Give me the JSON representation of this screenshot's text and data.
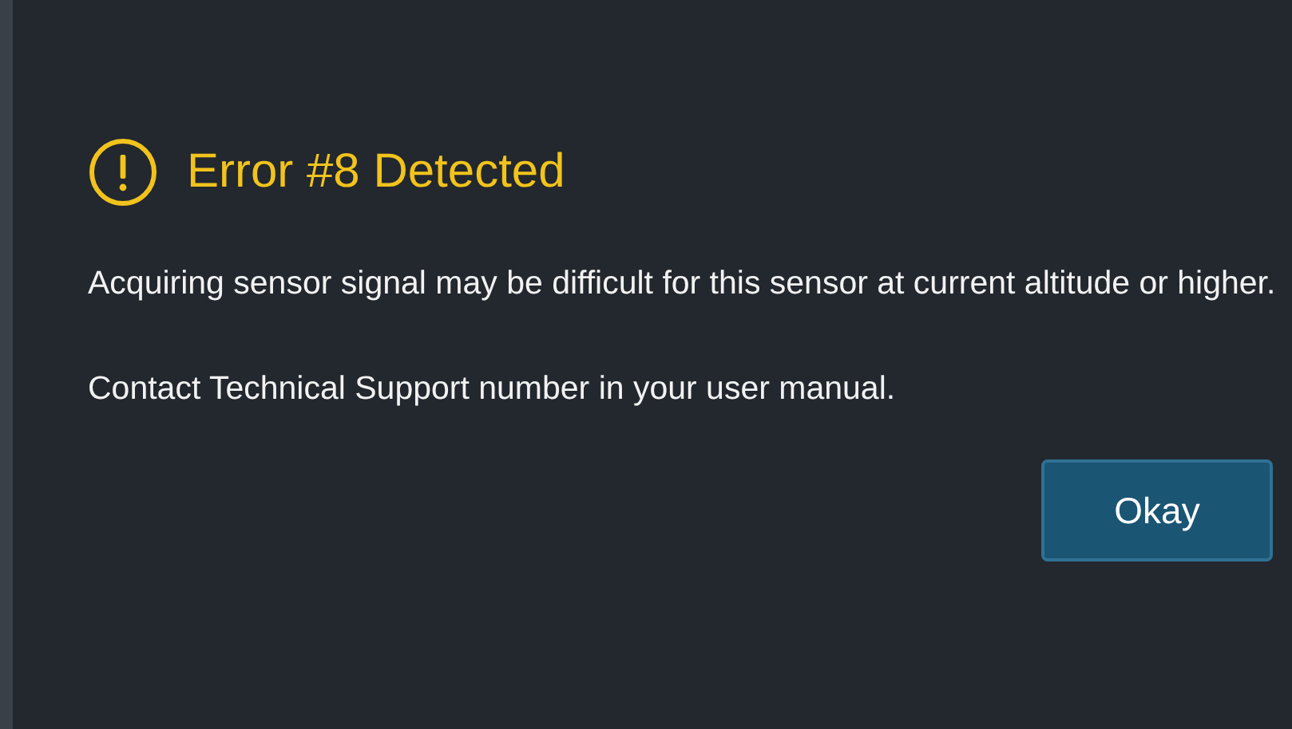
{
  "dialog": {
    "title": "Error #8 Detected",
    "messages": [
      "Acquiring sensor signal may be difficult for this sensor at current altitude or higher.",
      "Contact Technical Support number in your user manual."
    ],
    "buttons": [
      "Okay"
    ]
  }
}
